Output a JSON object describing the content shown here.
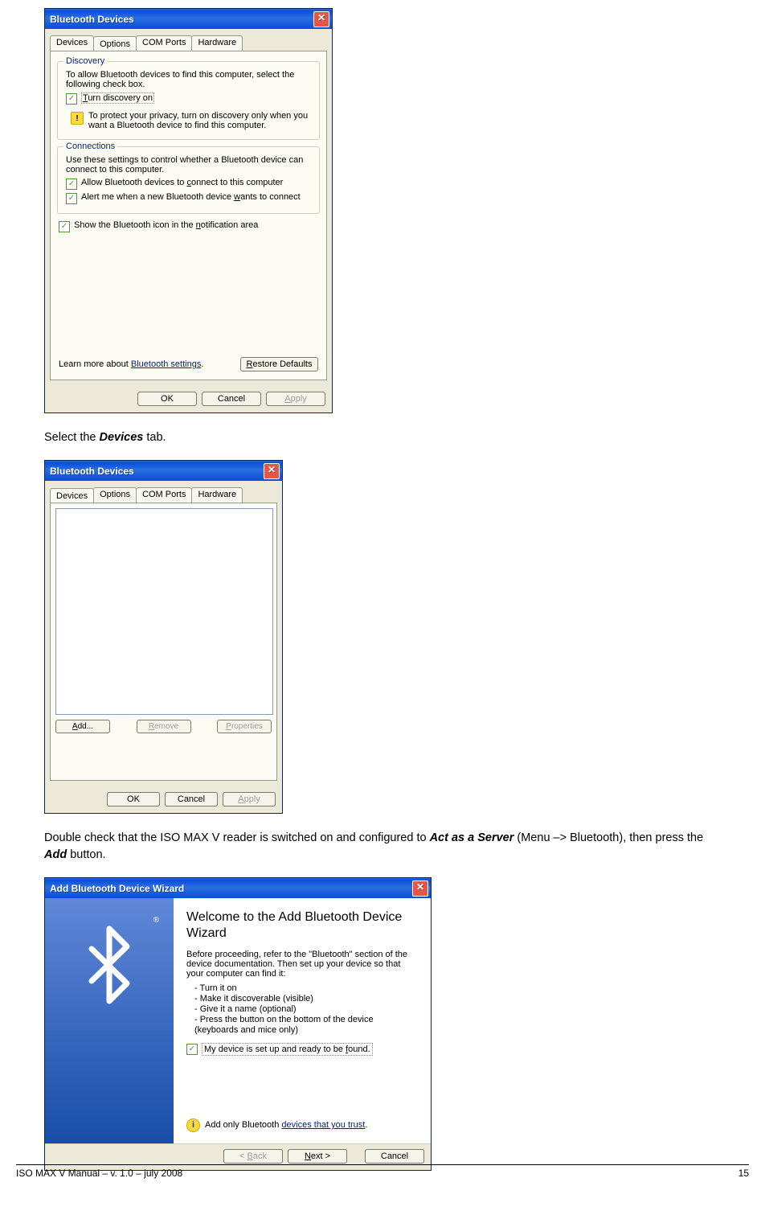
{
  "win1": {
    "title": "Bluetooth Devices",
    "tabs": [
      "Devices",
      "Options",
      "COM Ports",
      "Hardware"
    ],
    "active_tab": "Options",
    "discovery": {
      "legend": "Discovery",
      "intro": "To allow Bluetooth devices to find this computer, select the following check box.",
      "cb_label": "Turn discovery on",
      "warn_text": "To protect your privacy, turn on discovery only when you want a Bluetooth device to find this computer."
    },
    "connections": {
      "legend": "Connections",
      "intro": "Use these settings to control whether a Bluetooth device can connect to this computer.",
      "cb1": "Allow Bluetooth devices to connect to this computer",
      "cb2": "Alert me when a new Bluetooth device wants to connect"
    },
    "show_icon": "Show the Bluetooth icon in the notification area",
    "learn_more_pre": "Learn more about ",
    "learn_more_link": "Bluetooth settings",
    "restore": "Restore Defaults",
    "ok": "OK",
    "cancel": "Cancel",
    "apply": "Apply"
  },
  "instr1_pre": "Select the ",
  "instr1_bold": "Devices",
  "instr1_post": " tab.",
  "win2": {
    "title": "Bluetooth Devices",
    "tabs": [
      "Devices",
      "Options",
      "COM Ports",
      "Hardware"
    ],
    "active_tab": "Devices",
    "add": "Add...",
    "remove": "Remove",
    "properties": "Properties",
    "ok": "OK",
    "cancel": "Cancel",
    "apply": "Apply"
  },
  "instr2_pre": "Double check that the ISO MAX V reader is switched on and configured to ",
  "instr2_bold1": "Act as a Server",
  "instr2_mid": " (Menu –> Bluetooth), then press the ",
  "instr2_bold2": "Add",
  "instr2_post": " button.",
  "win3": {
    "title": "Add Bluetooth Device Wizard",
    "heading": "Welcome to the Add Bluetooth Device Wizard",
    "intro": "Before proceeding, refer to the \"Bluetooth\" section of the device documentation. Then set up your device so that your computer can find it:",
    "bullets": [
      "- Turn it on",
      "- Make it discoverable (visible)",
      "- Give it a name (optional)",
      "- Press the button on the bottom of the device",
      "  (keyboards and mice only)"
    ],
    "cb_label": "My device is set up and ready to be found.",
    "trust_pre": "Add only Bluetooth ",
    "trust_link": "devices that you trust",
    "back": "< Back",
    "next": "Next >",
    "cancel": "Cancel"
  },
  "footer": {
    "left": "ISO MAX V Manual – v. 1.0 – july 2008",
    "right": "15"
  }
}
